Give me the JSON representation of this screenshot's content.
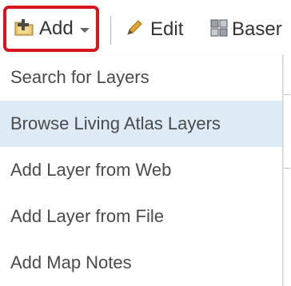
{
  "toolbar": {
    "add_label": "Add",
    "edit_label": "Edit",
    "basemap_label": "Baser"
  },
  "menu": {
    "items": [
      {
        "label": "Search for Layers"
      },
      {
        "label": "Browse Living Atlas Layers",
        "highlighted": true
      },
      {
        "label": "Add Layer from Web"
      },
      {
        "label": "Add Layer from File"
      },
      {
        "label": "Add Map Notes"
      }
    ]
  },
  "colors": {
    "highlight_ring": "#d8141c",
    "menu_hover": "#dcebf6",
    "text": "#333333"
  },
  "icons": {
    "add": "add-layer-icon",
    "caret": "caret-down-icon",
    "edit": "pencil-icon",
    "basemap": "basemap-grid-icon"
  }
}
